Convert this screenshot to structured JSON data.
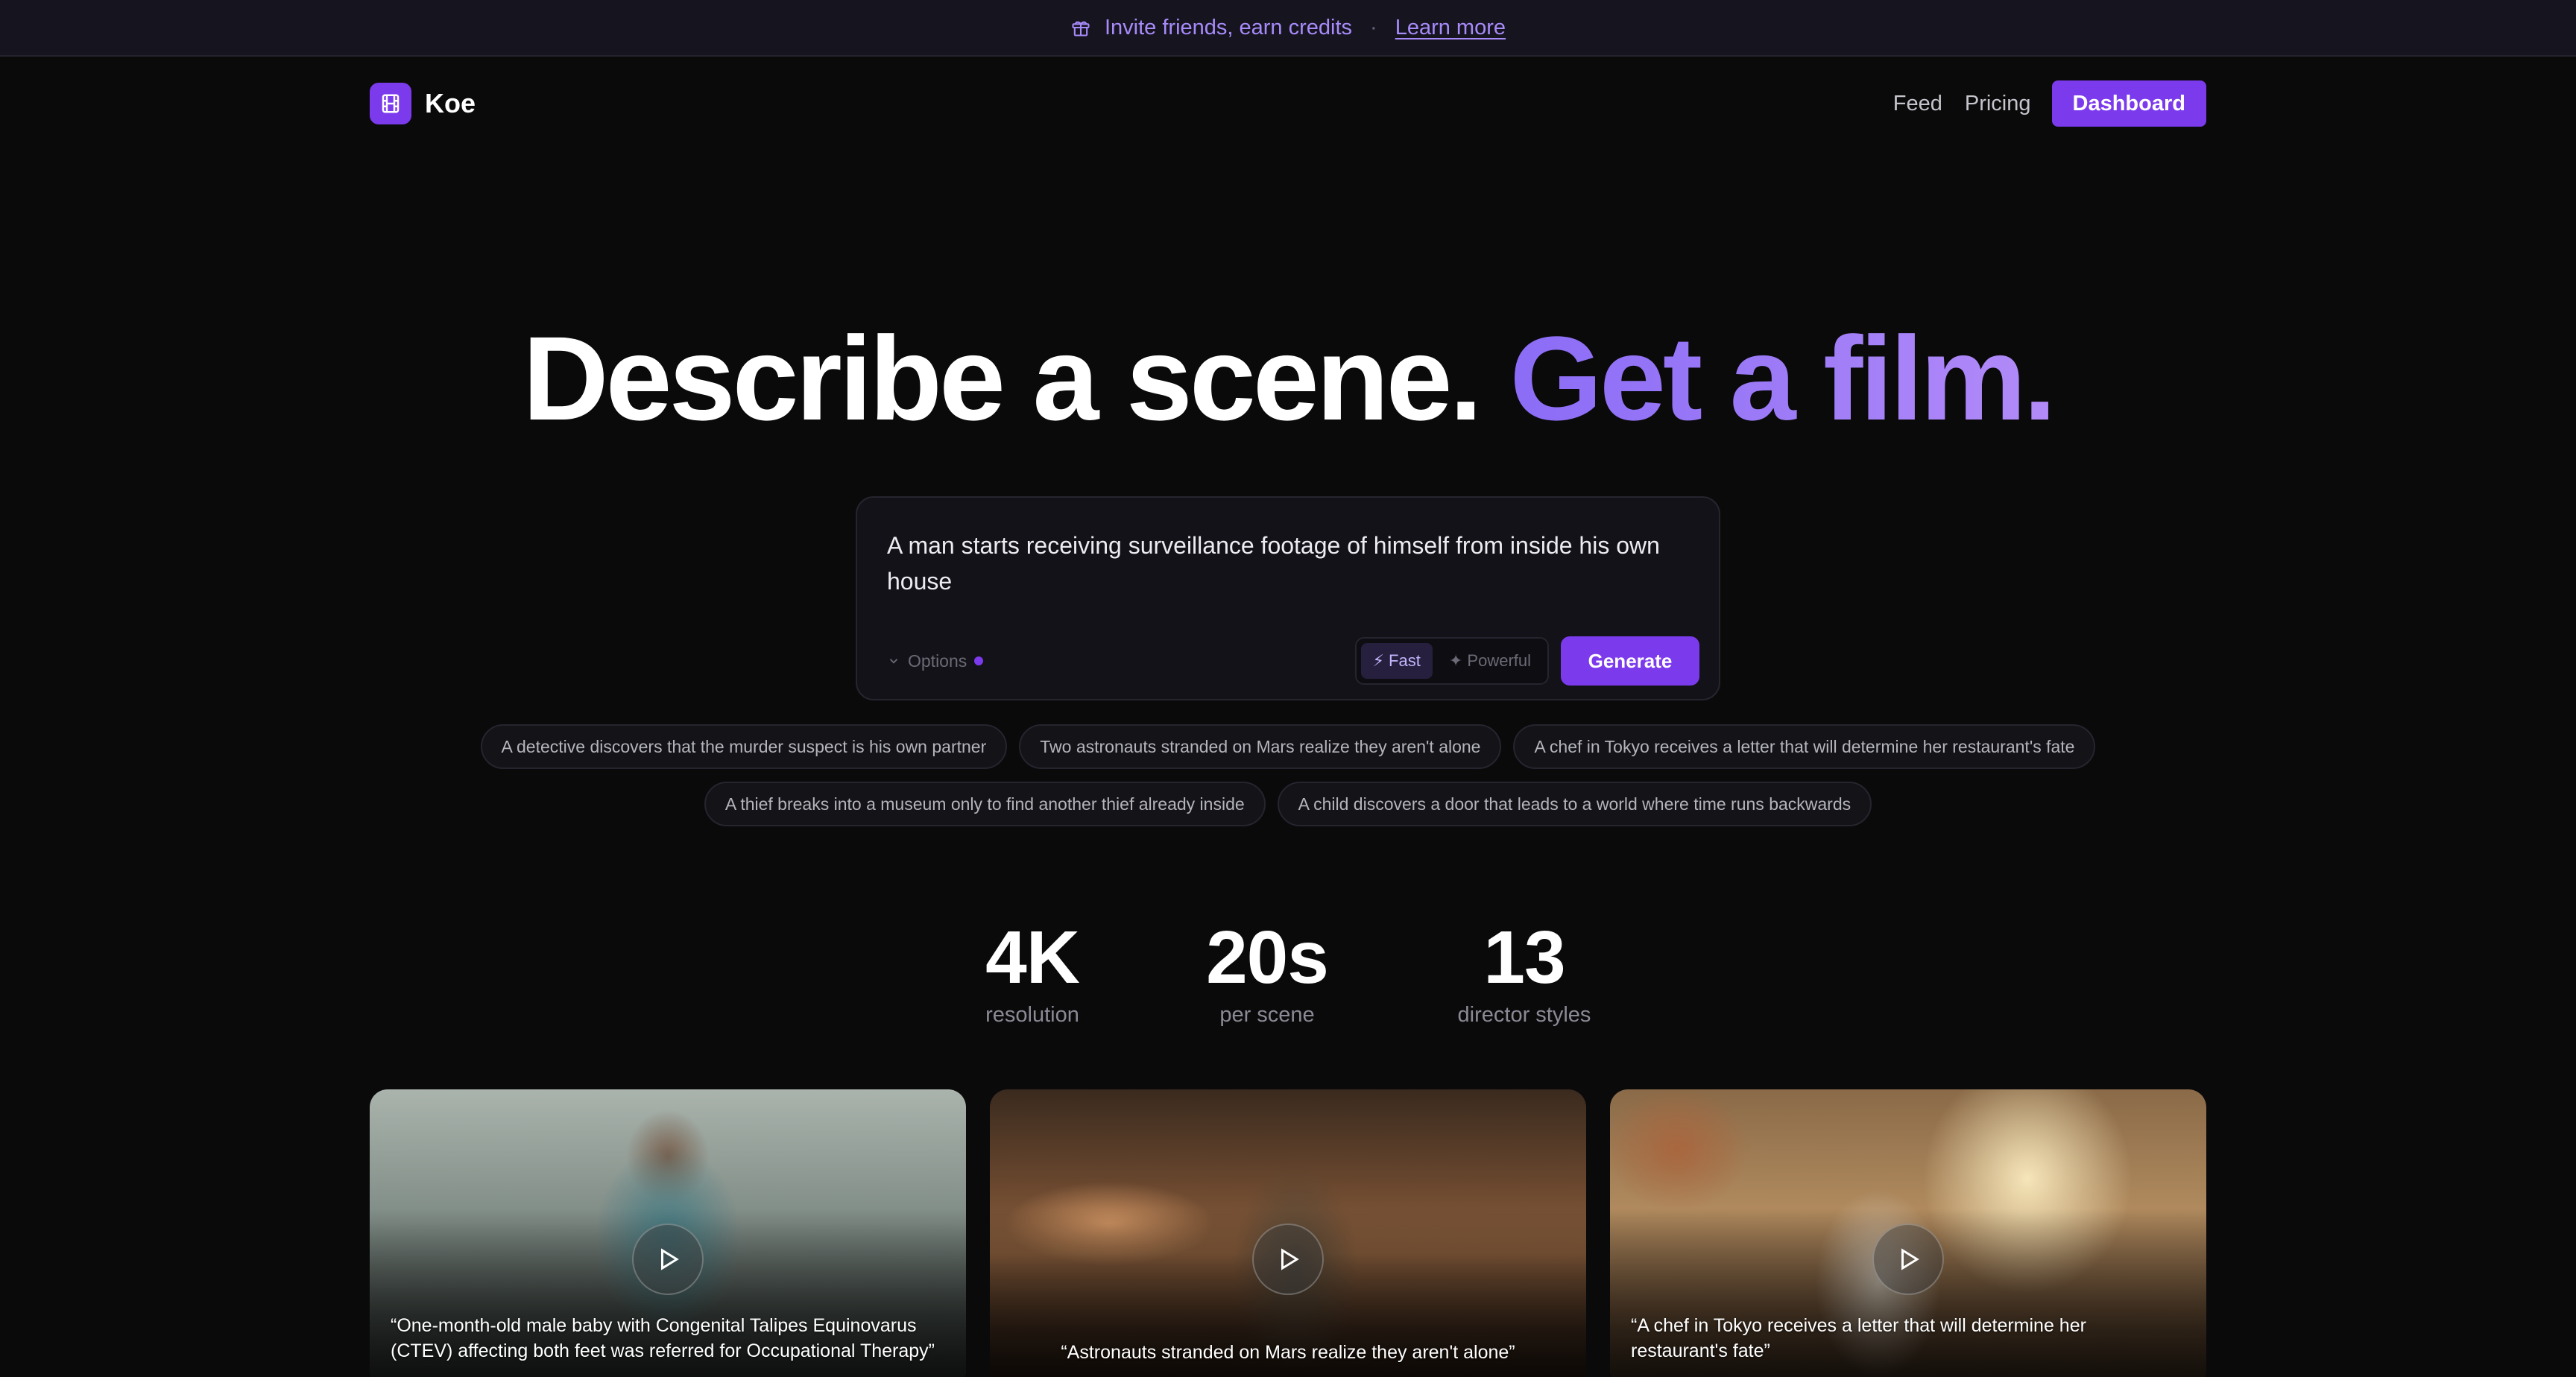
{
  "announcement": {
    "text": "Invite friends, earn credits",
    "separator": "·",
    "link": "Learn more"
  },
  "nav": {
    "brand": "Koe",
    "links": [
      "Feed",
      "Pricing"
    ],
    "cta": "Dashboard"
  },
  "hero": {
    "title_main": "Describe a scene.",
    "title_accent": "Get a film."
  },
  "prompt": {
    "value": "A man starts receiving surveillance footage of himself from inside his own house",
    "options_label": "Options",
    "modes": [
      {
        "label": "⚡ Fast",
        "active": true
      },
      {
        "label": "✦ Powerful",
        "active": false
      }
    ],
    "generate_label": "Generate"
  },
  "suggestions": {
    "row1": [
      "A detective discovers that the murder suspect is his own partner",
      "Two astronauts stranded on Mars realize they aren't alone",
      "A chef in Tokyo receives a letter that will determine her restaurant's fate"
    ],
    "row2": [
      "A thief breaks into a museum only to find another thief already inside",
      "A child discovers a door that leads to a world where time runs backwards"
    ]
  },
  "stats": [
    {
      "value": "4K",
      "label": "resolution"
    },
    {
      "value": "20s",
      "label": "per scene"
    },
    {
      "value": "13",
      "label": "director styles"
    }
  ],
  "videos": [
    {
      "caption": "“One-month-old male baby with Congenital Talipes Equinovarus (CTEV) affecting both feet was referred for Occupational Therapy”"
    },
    {
      "caption": "“Astronauts stranded on Mars realize they aren't alone”"
    },
    {
      "caption": "“A chef in Tokyo receives a letter that will determine her restaurant's fate”"
    }
  ],
  "colors": {
    "accent": "#7c3aed",
    "accent_text": "#a78bfa",
    "background": "#0a0a0b"
  }
}
